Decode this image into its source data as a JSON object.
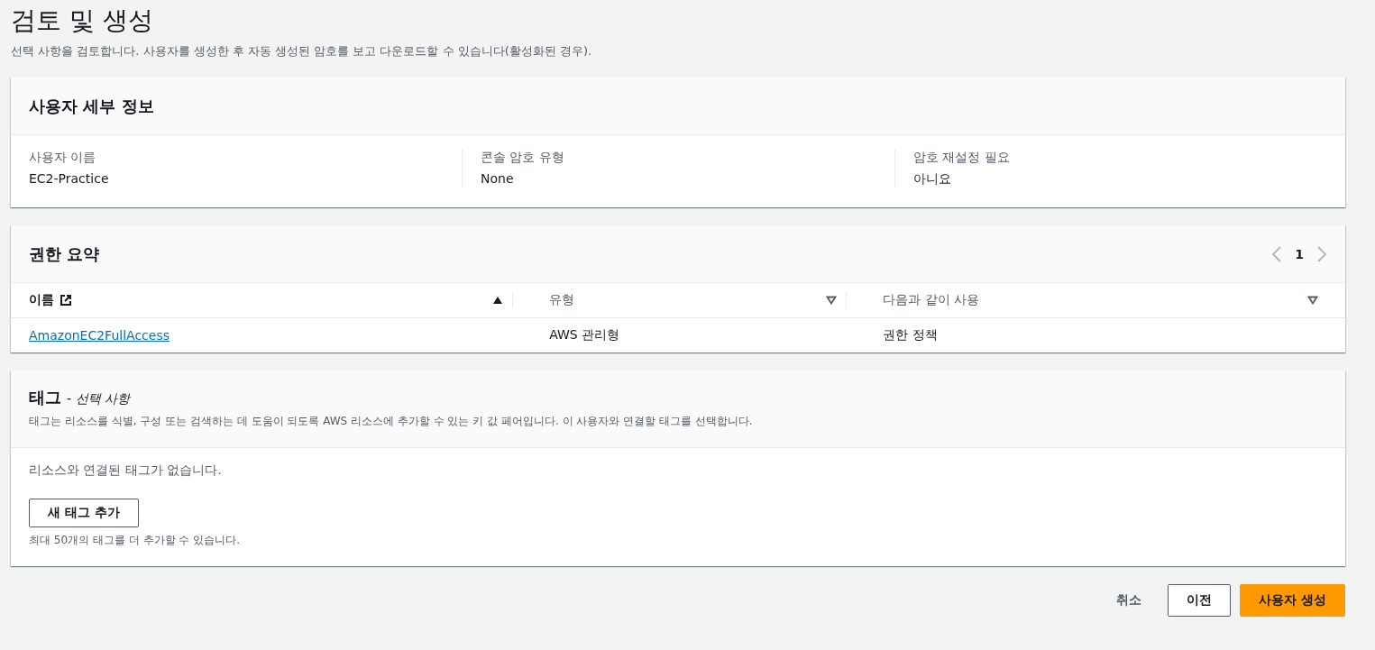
{
  "page": {
    "title": "검토 및 생성",
    "description": "선택 사항을 검토합니다. 사용자를 생성한 후 자동 생성된 암호를 보고 다운로드할 수 있습니다(활성화된 경우)."
  },
  "user_details": {
    "title": "사용자 세부 정보",
    "fields": [
      {
        "label": "사용자 이름",
        "value": "EC2-Practice"
      },
      {
        "label": "콘솔 암호 유형",
        "value": "None"
      },
      {
        "label": "암호 재설정 필요",
        "value": "아니요"
      }
    ]
  },
  "permissions": {
    "title": "권한 요약",
    "pagination": {
      "page": "1",
      "prev_disabled": true,
      "next_disabled": true
    },
    "columns": [
      {
        "label": "이름",
        "external_link": true,
        "sorted": true
      },
      {
        "label": "유형",
        "external_link": false,
        "sorted": false
      },
      {
        "label": "다음과 같이 사용",
        "external_link": false,
        "sorted": false
      }
    ],
    "rows": [
      {
        "name": "AmazonEC2FullAccess",
        "type": "AWS 관리형",
        "used_as": "권한 정책"
      }
    ]
  },
  "tags": {
    "title": "태그",
    "optional": "- 선택 사항",
    "description": "태그는 리소스를 식별, 구성 또는 검색하는 데 도움이 되도록 AWS 리소스에 추가할 수 있는 키 값 페어입니다. 이 사용자와 연결할 태그를 선택합니다.",
    "empty_text": "리소스와 연결된 태그가 없습니다.",
    "add_button": "새 태그 추가",
    "limit_text": "최대 50개의 태그를 더 추가할 수 있습니다."
  },
  "buttons": [
    {
      "label": "취소",
      "kind": "link"
    },
    {
      "label": "이전",
      "kind": "normal"
    },
    {
      "label": "사용자 생성",
      "kind": "primary"
    }
  ]
}
